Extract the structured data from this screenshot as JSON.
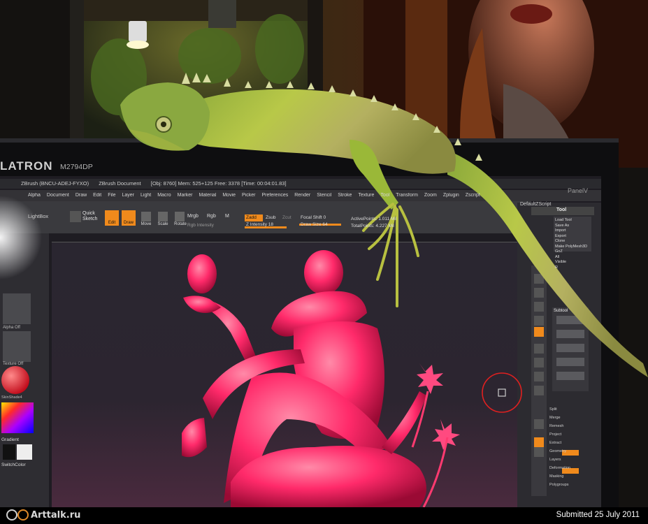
{
  "photo": {
    "monitor_brand": "LATRON",
    "monitor_model": "M2794DP",
    "bezel_right_label": "PanelV"
  },
  "zbrush": {
    "title_bar": {
      "left": "ZBrush (BNCU-ADEJ-FYXO)",
      "doc": "ZBrush Document",
      "stats": "[Obj: 8760]  Mem: 525+125  Free: 3378  [Time: 00:04:01.83]"
    },
    "menu": [
      "Alpha",
      "Document",
      "Draw",
      "Edit",
      "File",
      "Layer",
      "Light",
      "Macro",
      "Marker",
      "Material",
      "Movie",
      "Picker",
      "Preferences",
      "Render",
      "Stencil",
      "Stroke",
      "Texture",
      "Tool",
      "Transform",
      "Zoom",
      "Zplugin",
      "Zscript"
    ],
    "menu_right": "DefaultZScript",
    "toolbar": {
      "lightbox": "LightBox",
      "quick_sketch": "Quick Sketch",
      "edit": "Edit",
      "draw": "Draw",
      "move": "Move",
      "scale": "Scale",
      "rotate": "Rotate",
      "mrgb": "Mrgb",
      "rgb": "Rgb",
      "m": "M",
      "rgb_intensity": "Rgb Intensity",
      "zadd": "Zadd",
      "zsub": "Zsub",
      "zcut": "Zcut",
      "z_intensity": "Z Intensity 18",
      "focal_shift": "Focal Shift 0",
      "draw_size": "Draw Size 64",
      "active_points": "ActivePoints: 1.011 Mil",
      "total_points": "TotalPoints: 4.227 Mil"
    },
    "left_shelf": {
      "alpha_off": "Alpha Off",
      "texture_off": "Texture Off",
      "material": "SkinShade4",
      "gradient": "Gradient",
      "switch_color": "SwitchColor"
    },
    "tool_palette": {
      "title": "Tool",
      "buttons": [
        "Load Tool",
        "Save As",
        "Import",
        "Export",
        "Clone",
        "Make PolyMesh3D",
        "GoZ",
        "All",
        "Visible",
        "R"
      ],
      "subtools": "Subtool",
      "misc": [
        "Split",
        "Merge",
        "Remesh",
        "Project",
        "Extract",
        "Geometry",
        "Layers",
        "Deformation",
        "Masking",
        "Polygroups"
      ]
    }
  },
  "footer": {
    "site_logo": "Arttalk.ru",
    "credit": "Submitted 25 July 2011"
  },
  "colors": {
    "sculpt_pink": "#ff2a6a",
    "iguana_green": "#a8c23a",
    "zbrush_orange": "#f08a1c",
    "canvas_dark": "#1e1c22"
  }
}
